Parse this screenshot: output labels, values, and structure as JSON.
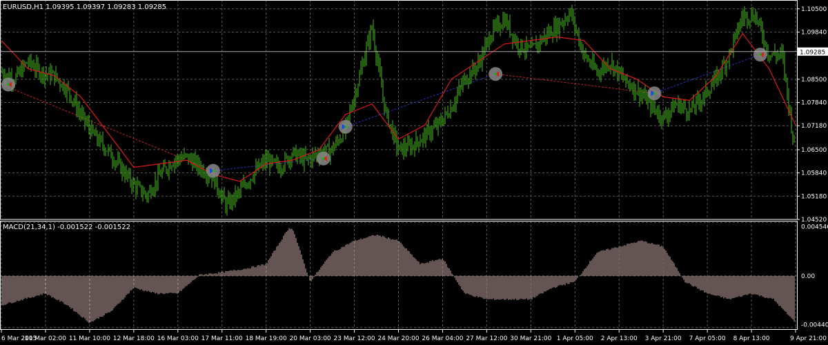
{
  "header": {
    "main_label": "EURUSD,H1  1.09395 1.09397 1.09283 1.09285",
    "macd_label": "MACD(21,34,1) -0.001522 -0.001522"
  },
  "colors": {
    "background": "#000000",
    "grid": "#5a5a5a",
    "candles": "#3c9a1e",
    "ma": "#e01818",
    "macd": "#c9a7a7",
    "buy_line": "#2a30b8",
    "sell_line": "#c02020",
    "price_label_bg": "#ffffff",
    "text": "#ffffff"
  },
  "chart_data": [
    {
      "type": "line",
      "title": "EURUSD,H1",
      "ohlc": {
        "open": 1.09395,
        "high": 1.09397,
        "low": 1.09283,
        "close": 1.09285
      },
      "current_price": 1.09285,
      "current_price_label": "1.09285",
      "ylim": [
        1.0452,
        1.1075
      ],
      "y_ticks": [
        "1.10500",
        "1.09840",
        "1.08500",
        "1.07840",
        "1.07180",
        "1.06500",
        "1.05840",
        "1.05180",
        "1.04520"
      ],
      "x_ticks": [
        "6 Mar 2015",
        "10 Mar 02:00",
        "11 Mar 10:00",
        "12 Mar 18:00",
        "16 Mar 03:00",
        "17 Mar 11:00",
        "18 Mar 19:00",
        "20 Mar 03:00",
        "23 Mar 12:00",
        "24 Mar 20:00",
        "26 Mar 04:00",
        "27 Mar 12:00",
        "30 Mar 21:00",
        "1 Apr 05:00",
        "2 Apr 13:00",
        "3 Apr 21:00",
        "7 Apr 05:00",
        "8 Apr 13:00",
        "9 Apr 21:00"
      ],
      "grid": true,
      "series": [
        {
          "kind": "price",
          "x": [
            0,
            3,
            6,
            9,
            12,
            15,
            18,
            21,
            24,
            27,
            30,
            33,
            36,
            39,
            42,
            45,
            48,
            51,
            54,
            57,
            60,
            63,
            66,
            69,
            72,
            75,
            78,
            81,
            84,
            87,
            90,
            93,
            96,
            99,
            102,
            105,
            108,
            111,
            114,
            117,
            120,
            123,
            126,
            129,
            132,
            135,
            138,
            141,
            144,
            147,
            150,
            153,
            156,
            159,
            162,
            165,
            168,
            171,
            174,
            177,
            180
          ],
          "values": [
            1.087,
            1.085,
            1.09,
            1.087,
            1.086,
            1.082,
            1.075,
            1.069,
            1.065,
            1.06,
            1.055,
            1.052,
            1.058,
            1.062,
            1.063,
            1.06,
            1.057,
            1.049,
            1.053,
            1.058,
            1.062,
            1.06,
            1.064,
            1.062,
            1.064,
            1.065,
            1.071,
            1.085,
            1.1,
            1.076,
            1.065,
            1.066,
            1.069,
            1.072,
            1.077,
            1.085,
            1.089,
            1.098,
            1.102,
            1.095,
            1.093,
            1.097,
            1.1,
            1.104,
            1.092,
            1.087,
            1.09,
            1.085,
            1.082,
            1.078,
            1.074,
            1.078,
            1.076,
            1.08,
            1.085,
            1.092,
            1.103,
            1.103,
            1.092,
            1.092,
            1.063
          ]
        },
        {
          "kind": "moving-average",
          "x": [
            0,
            6,
            12,
            18,
            24,
            30,
            36,
            42,
            48,
            54,
            60,
            66,
            72,
            78,
            84,
            90,
            96,
            102,
            108,
            114,
            120,
            126,
            132,
            138,
            144,
            150,
            156,
            162,
            168,
            174,
            180
          ],
          "values": [
            1.096,
            1.088,
            1.086,
            1.08,
            1.07,
            1.06,
            1.061,
            1.062,
            1.058,
            1.056,
            1.061,
            1.062,
            1.065,
            1.075,
            1.078,
            1.068,
            1.072,
            1.085,
            1.09,
            1.095,
            1.096,
            1.097,
            1.096,
            1.088,
            1.085,
            1.08,
            1.079,
            1.086,
            1.098,
            1.088,
            1.072
          ]
        }
      ],
      "trades": [
        {
          "x": 0,
          "price": 1.0835,
          "side": "sell"
        },
        {
          "x": 48,
          "price": 1.059,
          "side": "buy"
        },
        {
          "x": 73,
          "price": 1.0625,
          "side": "sell"
        },
        {
          "x": 78,
          "price": 1.0715,
          "side": "buy"
        },
        {
          "x": 112,
          "price": 1.0865,
          "side": "sell"
        },
        {
          "x": 148,
          "price": 1.081,
          "side": "buy"
        },
        {
          "x": 172,
          "price": 1.092,
          "side": "sell"
        }
      ]
    },
    {
      "type": "bar",
      "title": "MACD(21,34,1)",
      "values_label": "-0.001522 -0.001522",
      "ylim": [
        -0.0046,
        0.0047
      ],
      "y_ticks": [
        "0.004546",
        "0.00",
        "-0.004406"
      ],
      "x": [
        0,
        5,
        10,
        15,
        20,
        25,
        30,
        35,
        40,
        45,
        50,
        55,
        60,
        65,
        66,
        70,
        75,
        80,
        85,
        90,
        95,
        100,
        105,
        110,
        115,
        120,
        125,
        130,
        135,
        140,
        145,
        150,
        155,
        160,
        165,
        170,
        175,
        180
      ],
      "values": [
        -0.0025,
        -0.002,
        -0.0015,
        -0.0025,
        -0.004,
        -0.003,
        -0.001,
        -0.0015,
        -0.0015,
        0.0001,
        0.0003,
        0.0006,
        0.001,
        0.004,
        0.0041,
        -0.0005,
        0.002,
        0.003,
        0.0035,
        0.003,
        0.001,
        0.0015,
        -0.0015,
        -0.002,
        -0.002,
        -0.002,
        -0.001,
        -0.0005,
        0.002,
        0.0025,
        0.003,
        0.0025,
        -0.0005,
        -0.0015,
        -0.002,
        -0.0015,
        -0.002,
        -0.004
      ]
    }
  ]
}
